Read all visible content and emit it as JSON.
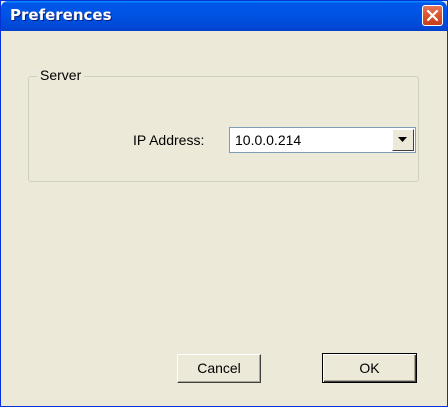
{
  "window": {
    "title": "Preferences",
    "close_icon": "close-icon"
  },
  "server_group": {
    "label": "Server",
    "ip_label": "IP Address:",
    "ip_value": "10.0.0.214",
    "dropdown_icon": "chevron-down-icon"
  },
  "buttons": {
    "cancel": "Cancel",
    "ok": "OK"
  },
  "colors": {
    "titlebar": "#0055e5",
    "face": "#ece9d8",
    "close": "#d9532d"
  }
}
